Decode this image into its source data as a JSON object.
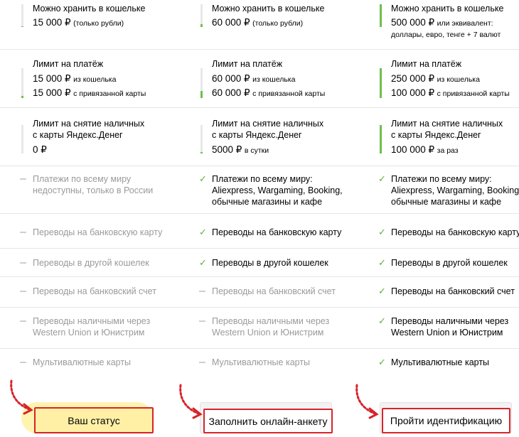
{
  "columns": [
    {
      "storage_label": "Можно хранить в кошельке",
      "storage_value": "15 000 ₽",
      "storage_note": "(только рубли)",
      "storage_note2": "",
      "storage_level": 0.03,
      "limit_label": "Лимит на платёж",
      "limit_wallet_value": "15 000 ₽",
      "limit_wallet_note": "из кошелька",
      "limit_card_value": "15 000 ₽",
      "limit_card_note": "с привязанной карты",
      "limit_level": 0.06,
      "cash_label_1": "Лимит на снятие наличных",
      "cash_label_2": "с карты Яндекс.Денег",
      "cash_value": "0 ₽",
      "cash_note": "",
      "cash_level": 0.0
    },
    {
      "storage_label": "Можно хранить в кошельке",
      "storage_value": "60 000 ₽",
      "storage_note": "(только рубли)",
      "storage_note2": "",
      "storage_level": 0.12,
      "limit_label": "Лимит на платёж",
      "limit_wallet_value": "60 000 ₽",
      "limit_wallet_note": "из кошелька",
      "limit_card_value": "60 000 ₽",
      "limit_card_note": "с привязанной карты",
      "limit_level": 0.24,
      "cash_label_1": "Лимит на снятие наличных",
      "cash_label_2": "с карты Яндекс.Денег",
      "cash_value": "5000 ₽",
      "cash_note": "в сутки",
      "cash_level": 0.05
    },
    {
      "storage_label": "Можно хранить в кошельке",
      "storage_value": "500 000 ₽",
      "storage_note": "или эквивалент:",
      "storage_note2": "доллары, евро, тенге + 7 валют",
      "storage_level": 1.0,
      "limit_label": "Лимит на платёж",
      "limit_wallet_value": "250 000 ₽",
      "limit_wallet_note": "из кошелька",
      "limit_card_value": "100 000 ₽",
      "limit_card_note": "с привязанной карты",
      "limit_level": 1.0,
      "cash_label_1": "Лимит на снятие наличных",
      "cash_label_2": "с карты Яндекс.Денег",
      "cash_value": "100 000 ₽",
      "cash_note": "за раз",
      "cash_level": 1.0
    }
  ],
  "features": [
    {
      "lines": [
        "Платежи по всему миру",
        "недоступны, только в России"
      ],
      "lines_on": [
        "Платежи по всему миру:",
        "Aliexpress, Wargaming, Booking,",
        "обычные магазины и кафе"
      ],
      "status": [
        false,
        true,
        true
      ]
    },
    {
      "lines": [
        "Переводы на банковскую карту"
      ],
      "status": [
        false,
        true,
        true
      ]
    },
    {
      "lines": [
        "Переводы в другой кошелек"
      ],
      "status": [
        false,
        true,
        true
      ]
    },
    {
      "lines": [
        "Переводы на банковский счет"
      ],
      "status": [
        false,
        false,
        true
      ]
    },
    {
      "lines": [
        "Переводы наличными через",
        "Western Union и Юнистрим"
      ],
      "status": [
        false,
        false,
        true
      ]
    },
    {
      "lines": [
        "Мультивалютные карты"
      ],
      "status": [
        false,
        false,
        true
      ]
    }
  ],
  "buttons": {
    "status": "Ваш статус",
    "form": "Заполнить онлайн-анкету",
    "identify": "Пройти идентификацию"
  },
  "colors": {
    "accent_green": "#6cc04a",
    "highlight_red": "#d8232a",
    "status_yellow": "#fff0a5"
  }
}
